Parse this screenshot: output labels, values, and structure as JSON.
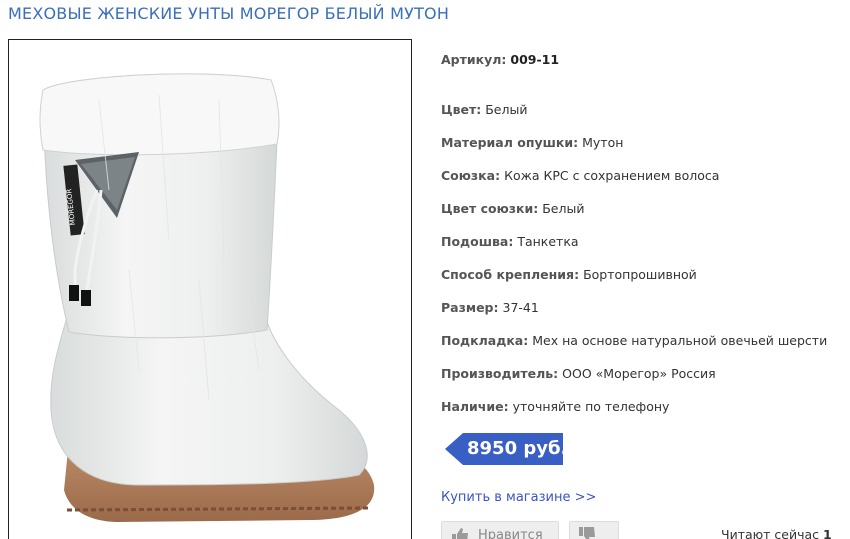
{
  "product": {
    "title": "МЕХОВЫЕ ЖЕНСКИЕ УНТЫ МОРЕГОР БЕЛЫЙ МУТОН",
    "image_tag_text": "MOREGOR"
  },
  "specs": [
    {
      "label": "Артикул:",
      "value": "009-11"
    },
    {
      "label": "Цвет:",
      "value": "Белый"
    },
    {
      "label": "Материал опушки:",
      "value": "Мутон"
    },
    {
      "label": "Союзка:",
      "value": "Кожа КРС с сохранением волоса"
    },
    {
      "label": "Цвет союзки:",
      "value": "Белый"
    },
    {
      "label": "Подошва:",
      "value": "Танкетка"
    },
    {
      "label": "Способ крепления:",
      "value": "Бортопрошивной"
    },
    {
      "label": "Размер:",
      "value": "37-41"
    },
    {
      "label": "Подкладка:",
      "value": "Мех на основе натуральной овечьей шерсти"
    },
    {
      "label": "Производитель:",
      "value": "ООО «Морегор» Россия"
    },
    {
      "label": "Наличие:",
      "value": "уточняйте по телефону"
    }
  ],
  "price": {
    "text": "8950 руб.",
    "color": "#3a5fc4"
  },
  "buy_link": "Купить в магазине >>",
  "social": {
    "like_label": "Нравится",
    "like_icon": "thumbs-up-icon",
    "dislike_icon": "thumbs-down-icon"
  },
  "reading_now": {
    "label": "Читают сейчас",
    "count": "1"
  }
}
